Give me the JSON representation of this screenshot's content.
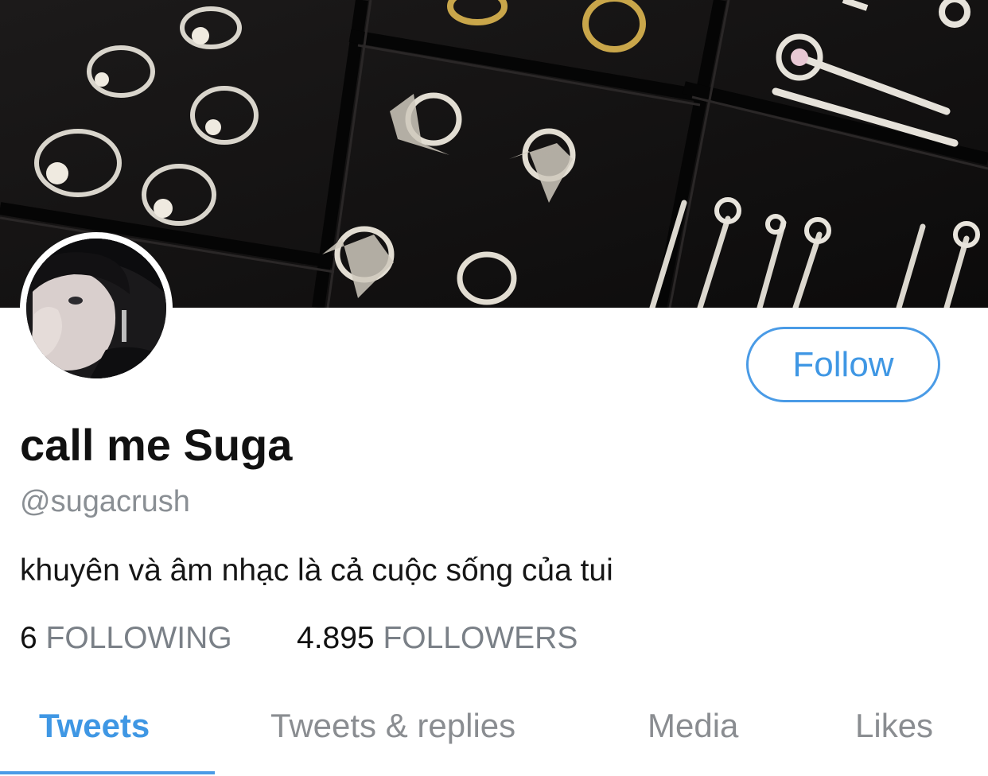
{
  "profile": {
    "display_name": "call me Suga",
    "handle": "@sugacrush",
    "bio": "khuyên và âm nhạc là cả cuộc sống của tui",
    "follow_label": "Follow"
  },
  "stats": {
    "following_count": "6",
    "following_label": "FOLLOWING",
    "followers_count": "4.895",
    "followers_label": "FOLLOWERS"
  },
  "tabs": [
    {
      "label": "Tweets",
      "active": true
    },
    {
      "label": "Tweets & replies",
      "active": false
    },
    {
      "label": "Media",
      "active": false
    },
    {
      "label": "Likes",
      "active": false
    }
  ],
  "colors": {
    "accent": "#4a9be6",
    "secondary_text": "#8a8f94"
  }
}
